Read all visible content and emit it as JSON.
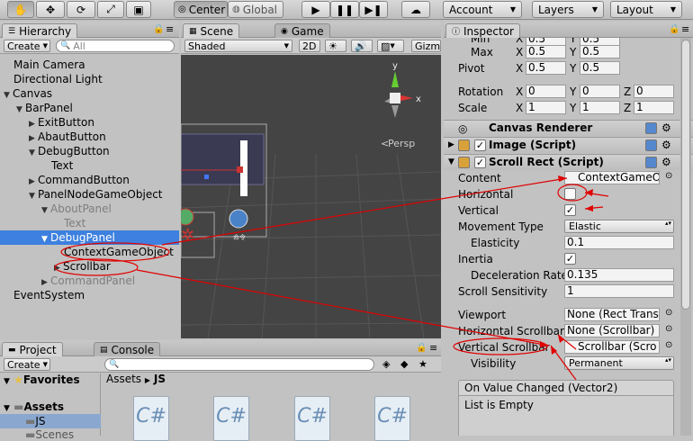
{
  "toolbar": {
    "pivot_label": "Center",
    "space_label": "Global",
    "account_label": "Account",
    "layers_label": "Layers",
    "layout_label": "Layout"
  },
  "hierarchy": {
    "tab_label": "Hierarchy",
    "create_label": "Create",
    "search_placeholder": "All",
    "items": [
      {
        "label": "Main Camera"
      },
      {
        "label": "Directional Light"
      },
      {
        "label": "Canvas"
      },
      {
        "label": "BarPanel"
      },
      {
        "label": "ExitButton"
      },
      {
        "label": "AbautButton"
      },
      {
        "label": "DebugButton"
      },
      {
        "label": "Text"
      },
      {
        "label": "CommandButton"
      },
      {
        "label": "PanelNodeGameObject"
      },
      {
        "label": "AboutPanel"
      },
      {
        "label": "Text"
      },
      {
        "label": "DebugPanel"
      },
      {
        "label": "ContextGameObject"
      },
      {
        "label": "Scrollbar"
      },
      {
        "label": "CommandPanel"
      },
      {
        "label": "EventSystem"
      }
    ]
  },
  "scene": {
    "scene_tab": "Scene",
    "game_tab": "Game",
    "shading": "Shaded",
    "mode_2d": "2D",
    "gizmos_label": "Gizm",
    "persp_label": "Persp",
    "axis_y": "y",
    "axis_x": "x"
  },
  "inspector": {
    "tab_label": "Inspector",
    "min_label": "Min",
    "max_label": "Max",
    "max_x": "0.5",
    "max_y": "0.5",
    "min_x": "0.5",
    "min_y": "0.5",
    "pivot_label": "Pivot",
    "pivot_x": "0.5",
    "pivot_y": "0.5",
    "rotation_label": "Rotation",
    "rot_x": "0",
    "rot_y": "0",
    "rot_z": "0",
    "scale_label": "Scale",
    "scale_x": "1",
    "scale_y": "1",
    "scale_z": "1",
    "x": "X",
    "y": "Y",
    "z": "Z",
    "canvas_renderer": "Canvas Renderer",
    "image_script": "Image (Script)",
    "scroll_rect": "Scroll Rect (Script)",
    "content_label": "Content",
    "content_value": "ContextGameO",
    "horizontal_label": "Horizontal",
    "vertical_label": "Vertical",
    "vertical_check": "✓",
    "movement_label": "Movement Type",
    "movement_value": "Elastic",
    "elasticity_label": "Elasticity",
    "elasticity_value": "0.1",
    "inertia_label": "Inertia",
    "inertia_check": "✓",
    "decel_label": "Deceleration Rate",
    "decel_value": "0.135",
    "sensitivity_label": "Scroll Sensitivity",
    "sensitivity_value": "1",
    "viewport_label": "Viewport",
    "viewport_value": "None (Rect Trans",
    "hscroll_label": "Horizontal Scrollbar",
    "hscroll_value": "None (Scrollbar)",
    "vscroll_label": "Vertical Scrollbar",
    "vscroll_value": "Scrollbar (Scro",
    "visibility_label": "Visibility",
    "visibility_value": "Permanent",
    "event_label": "On Value Changed (Vector2)",
    "event_empty": "List is Empty"
  },
  "project": {
    "project_tab": "Project",
    "console_tab": "Console",
    "create_label": "Create",
    "favorites_label": "Favorites",
    "assets_label": "Assets",
    "js_label": "JS",
    "scenes_label": "Scenes",
    "breadcrumb_assets": "Assets",
    "breadcrumb_js": "JS",
    "asset_icon_text": "C#"
  },
  "colors": {
    "selection": "#3d80df",
    "annotation": "#e00000"
  }
}
